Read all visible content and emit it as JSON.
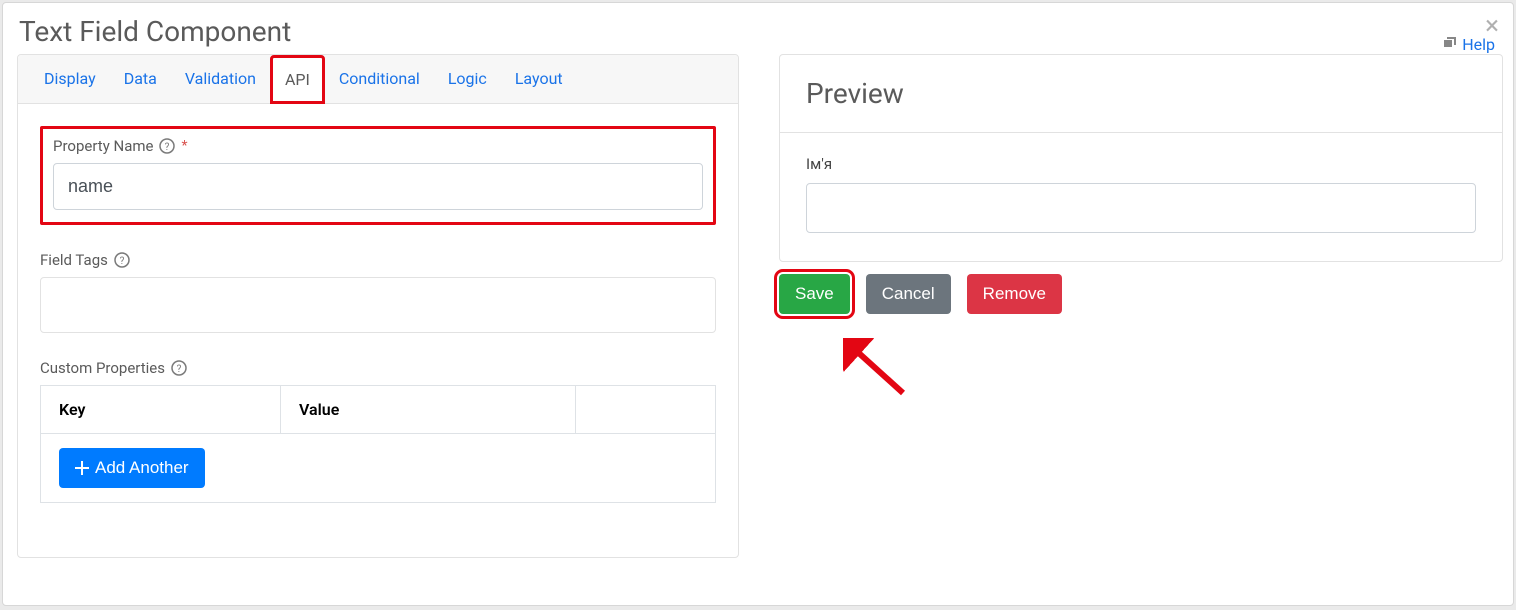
{
  "modal": {
    "title": "Text Field Component",
    "help_label": "Help"
  },
  "tabs": {
    "display": "Display",
    "data": "Data",
    "validation": "Validation",
    "api": "API",
    "conditional": "Conditional",
    "logic": "Logic",
    "layout": "Layout"
  },
  "api_panel": {
    "property_name_label": "Property Name",
    "property_name_value": "name",
    "field_tags_label": "Field Tags",
    "custom_properties_label": "Custom Properties",
    "key_header": "Key",
    "value_header": "Value",
    "add_another_label": "Add Another"
  },
  "preview": {
    "title": "Preview",
    "field_label": "Ім'я",
    "field_value": ""
  },
  "actions": {
    "save": "Save",
    "cancel": "Cancel",
    "remove": "Remove"
  }
}
